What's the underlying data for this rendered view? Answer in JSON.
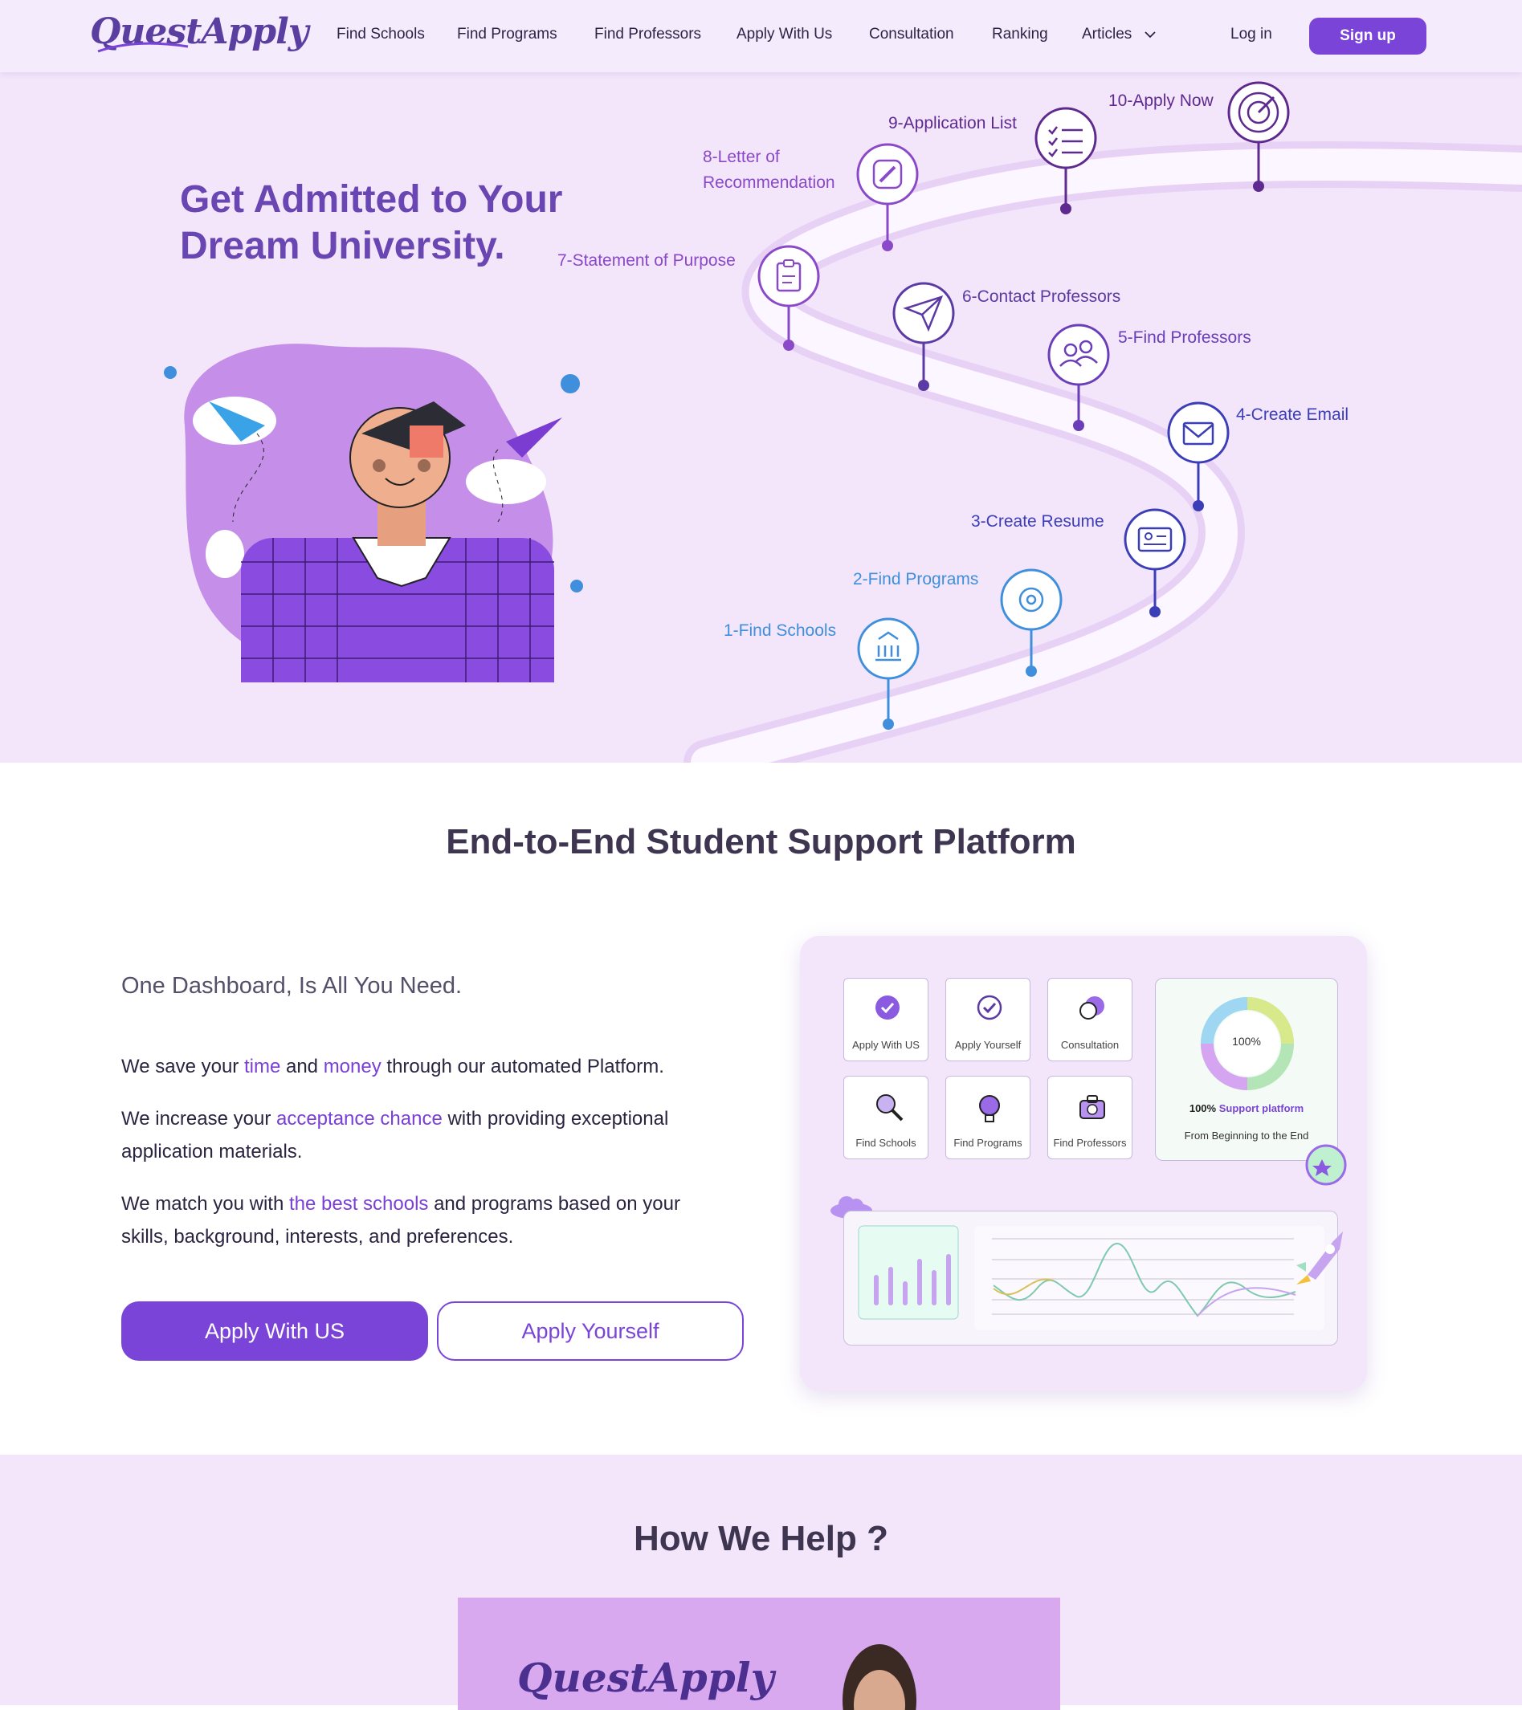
{
  "brand": {
    "name": "QuestApply"
  },
  "nav": {
    "items": [
      "Find Schools",
      "Find Programs",
      "Find Professors",
      "Apply With Us",
      "Consultation",
      "Ranking",
      "Articles"
    ],
    "login": "Log in",
    "signup": "Sign up"
  },
  "hero": {
    "title_line1": "Get Admitted to Your",
    "title_line2": "Dream University.",
    "steps": [
      "1-Find Schools",
      "2-Find Programs",
      "3-Create Resume",
      "4-Create Email",
      "5-Find Professors",
      "6-Contact Professors",
      "7-Statement of Purpose",
      "8-Letter of",
      "Recommendation",
      "9-Application List",
      "10-Apply Now"
    ]
  },
  "platform": {
    "title": "End-to-End Student Support Platform",
    "subtitle": "One Dashboard, Is All You Need.",
    "p1": {
      "a": "We save your ",
      "b": "time",
      "c": " and ",
      "d": "money",
      "e": " through our automated Platform."
    },
    "p2": {
      "a": "We increase your ",
      "b": "acceptance chance",
      "c": " with providing exceptional application materials."
    },
    "p3": {
      "a": "We match you with ",
      "b": "the best schools",
      "c": " and programs based on your skills, background, interests, and preferences."
    },
    "btn_primary": "Apply With US",
    "btn_outline": "Apply Yourself",
    "dashboard": {
      "tiles": [
        "Apply With US",
        "Apply Yourself",
        "Consultation",
        "Find Schools",
        "Find Programs",
        "Find Professors"
      ],
      "progress": "100%",
      "support_prefix": "100%",
      "support_text": "Support platform",
      "support_sub": "From Beginning to the End"
    }
  },
  "help": {
    "title": "How We Help ?",
    "video_logo": "QuestApply"
  },
  "colors": {
    "accent": "#7a44d8",
    "hero_bg": "#f3e6fb",
    "step_blue": "#3f8fdc",
    "step_purple": "#8a49c8"
  }
}
